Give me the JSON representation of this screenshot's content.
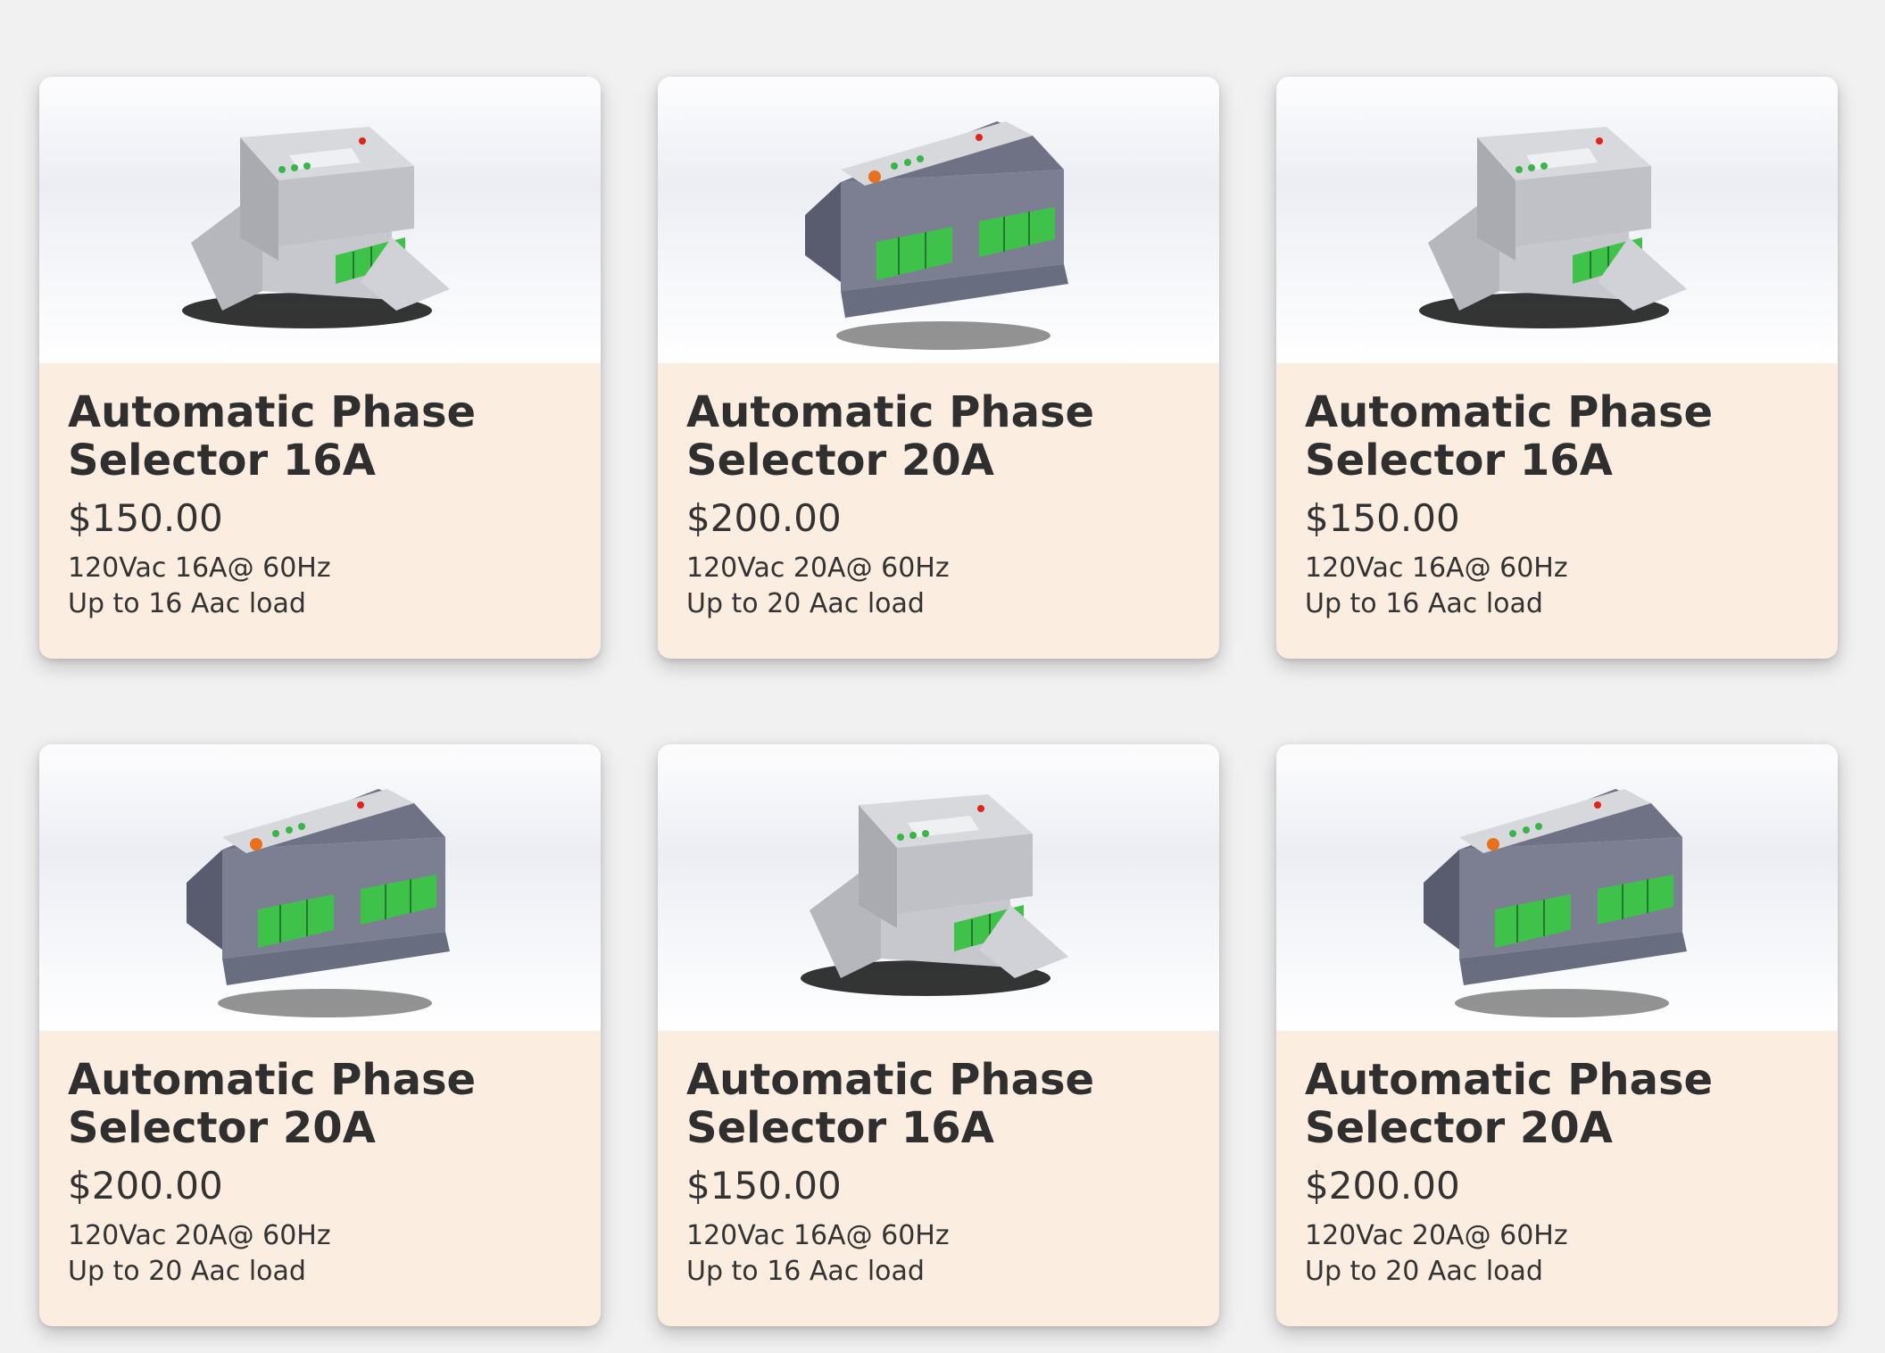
{
  "products": [
    {
      "title": "Automatic Phase Selector 16A",
      "price": "$150.00",
      "spec_line1": "120Vac 16A@ 60Hz",
      "spec_line2": "Up to 16 Aac load",
      "variant": "light-gray",
      "image_icon": "phase-selector-device-image"
    },
    {
      "title": "Automatic Phase Selector 20A",
      "price": "$200.00",
      "spec_line1": "120Vac 20A@ 60Hz",
      "spec_line2": "Up to 20 Aac load",
      "variant": "dark-gray",
      "image_icon": "phase-selector-device-image"
    },
    {
      "title": "Automatic Phase Selector 16A",
      "price": "$150.00",
      "spec_line1": "120Vac 16A@ 60Hz",
      "spec_line2": "Up to 16 Aac load",
      "variant": "light-gray",
      "image_icon": "phase-selector-device-image"
    },
    {
      "title": "Automatic Phase Selector 20A",
      "price": "$200.00",
      "spec_line1": "120Vac 20A@ 60Hz",
      "spec_line2": "Up to 20 Aac load",
      "variant": "dark-gray",
      "image_icon": "phase-selector-device-image"
    },
    {
      "title": "Automatic Phase Selector 16A",
      "price": "$150.00",
      "spec_line1": "120Vac 16A@ 60Hz",
      "spec_line2": "Up to 16 Aac load",
      "variant": "light-gray",
      "image_icon": "phase-selector-device-image"
    },
    {
      "title": "Automatic Phase Selector 20A",
      "price": "$200.00",
      "spec_line1": "120Vac 20A@ 60Hz",
      "spec_line2": "Up to 20 Aac load",
      "variant": "dark-gray",
      "image_icon": "phase-selector-device-image"
    }
  ],
  "colors": {
    "page_background": "#f1f1f1",
    "card_body": "#fcede1",
    "text": "#333333",
    "terminal_green": "#3ec24a",
    "device_light": "#c9cbd0",
    "device_dark": "#6f7385"
  }
}
